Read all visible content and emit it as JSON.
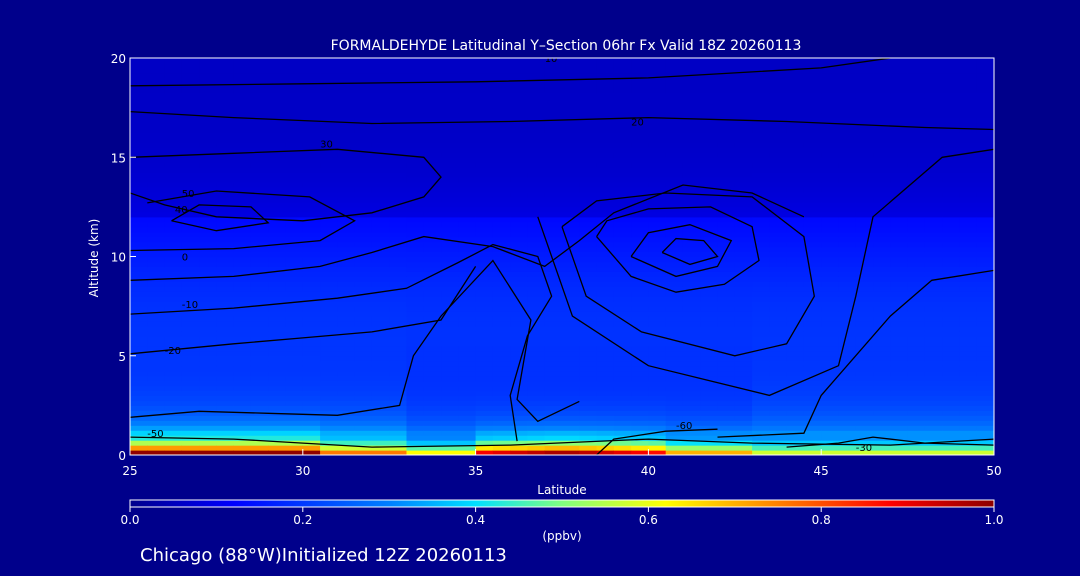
{
  "title": "FORMALDEHYDE Latitudinal Y–Section 06hr  Fx Valid 18Z 20260113",
  "footer": "Chicago (88°W)Initialized 12Z 20260113",
  "chart_data": {
    "type": "heatmap",
    "title": "FORMALDEHYDE Latitudinal Y–Section 06hr  Fx Valid 18Z 20260113",
    "xlabel": "Latitude",
    "ylabel": "Altitude (km)",
    "xlim": [
      25,
      50
    ],
    "ylim": [
      0,
      20
    ],
    "xticks": [
      "25",
      "30",
      "35",
      "40",
      "45",
      "50"
    ],
    "yticks": [
      "0",
      "5",
      "10",
      "15",
      "20"
    ],
    "colorbar": {
      "label": "(ppbv)",
      "min": 0.0,
      "max": 1.0,
      "ticks": [
        "0.0",
        "0.2",
        "0.4",
        "0.6",
        "0.8",
        "1.0"
      ],
      "colors": [
        "#00008b",
        "#0000ff",
        "#0080ff",
        "#00e0ff",
        "#80ff80",
        "#ffff00",
        "#ff8000",
        "#ff0000",
        "#8b0000"
      ]
    },
    "contour_labels": [
      "10",
      "20",
      "30",
      "40",
      "50",
      "0",
      "-10",
      "-20",
      "-50",
      "-60",
      "-30"
    ],
    "field_notes": "High concentrations near surface at 25-43 latitude (up to ~1.0 ppbv), decreasing with altitude."
  },
  "colors": {
    "background": "#00008b",
    "text": "#ffffff",
    "contour": "#000000"
  }
}
